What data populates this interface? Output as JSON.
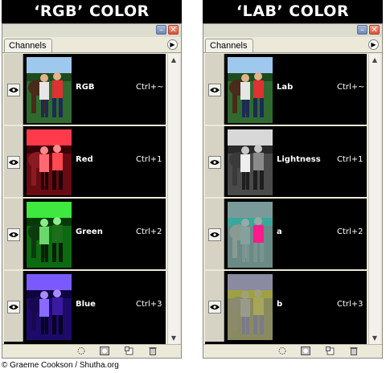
{
  "headings": {
    "left": "‘RGB’ COLOR",
    "right": "‘LAB’ COLOR"
  },
  "panels": [
    {
      "tab_label": "Channels",
      "channels": [
        {
          "name": "RGB",
          "shortcut": "Ctrl+~",
          "thumb": "color"
        },
        {
          "name": "Red",
          "shortcut": "Ctrl+1",
          "thumb": "red"
        },
        {
          "name": "Green",
          "shortcut": "Ctrl+2",
          "thumb": "green"
        },
        {
          "name": "Blue",
          "shortcut": "Ctrl+3",
          "thumb": "blue"
        }
      ]
    },
    {
      "tab_label": "Channels",
      "channels": [
        {
          "name": "Lab",
          "shortcut": "Ctrl+~",
          "thumb": "color"
        },
        {
          "name": "Lightness",
          "shortcut": "Ctrl+1",
          "thumb": "gray"
        },
        {
          "name": "a",
          "shortcut": "Ctrl+2",
          "thumb": "a"
        },
        {
          "name": "b",
          "shortcut": "Ctrl+3",
          "thumb": "b"
        }
      ]
    }
  ],
  "credit": "© Graeme Cookson / Shutha.org",
  "icons": {
    "minimize": "minimize-icon",
    "close": "close-icon",
    "menu": "panel-menu-icon",
    "visibility": "eye-icon",
    "load_selection": "dotted-circle-icon",
    "save_selection": "mask-icon",
    "new_channel": "new-channel-icon",
    "delete_channel": "trash-icon"
  }
}
